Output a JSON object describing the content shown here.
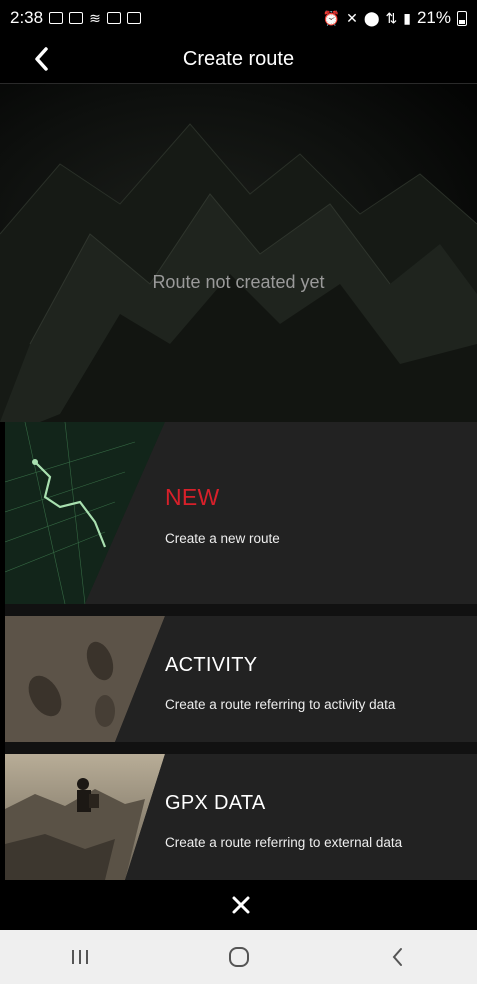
{
  "status_bar": {
    "time": "2:38",
    "battery": "21%",
    "left_icons": [
      "gmail-icon",
      "gmail-icon",
      "wifi-calling-icon",
      "image-icon",
      "calendar-icon"
    ],
    "right_icons": [
      "alarm-icon",
      "mute-icon",
      "location-icon",
      "data-icon",
      "signal-icon"
    ]
  },
  "header": {
    "title": "Create route"
  },
  "hero": {
    "message": "Route not created yet"
  },
  "options": [
    {
      "title": "NEW",
      "subtitle": "Create a new route"
    },
    {
      "title": "ACTIVITY",
      "subtitle": "Create a route referring to activity data"
    },
    {
      "title": "GPX DATA",
      "subtitle": "Create a route referring to external data"
    }
  ],
  "colors": {
    "accent": "#d8202a",
    "card_bg": "#222222",
    "background": "#000000"
  }
}
